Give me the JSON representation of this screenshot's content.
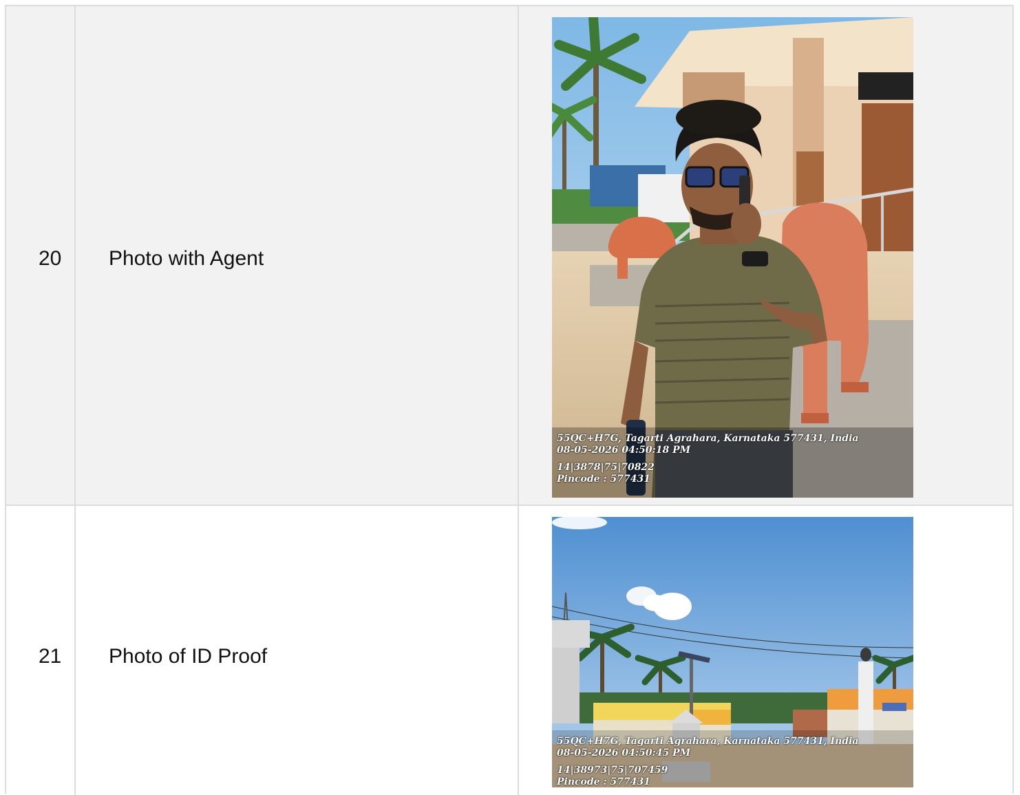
{
  "rows": [
    {
      "number": "20",
      "label": "Photo with Agent",
      "photo": {
        "icon": "person-photo-icon",
        "stamp": {
          "address": "55QC+H7G, Tagarti Agrahara, Karnataka 577431, India",
          "datetime": "08-05-2026 04:50:18 PM",
          "coordinates": "14|3878|75|70822",
          "pincode": "Pincode : 577431"
        }
      }
    },
    {
      "number": "21",
      "label": "Photo of ID Proof",
      "photo": {
        "icon": "street-scene-photo-icon",
        "stamp": {
          "address": "55QC+H7G, Tagarti Agrahara, Karnataka 577431, India",
          "datetime": "08-05-2026 04:50:45 PM",
          "coordinates": "14|38973|75|707459",
          "pincode": "Pincode : 577431"
        }
      }
    }
  ],
  "colors": {
    "border": "#dcdcdc",
    "row_shaded": "#f2f2f2",
    "row_plain": "#ffffff",
    "text": "#111111"
  }
}
